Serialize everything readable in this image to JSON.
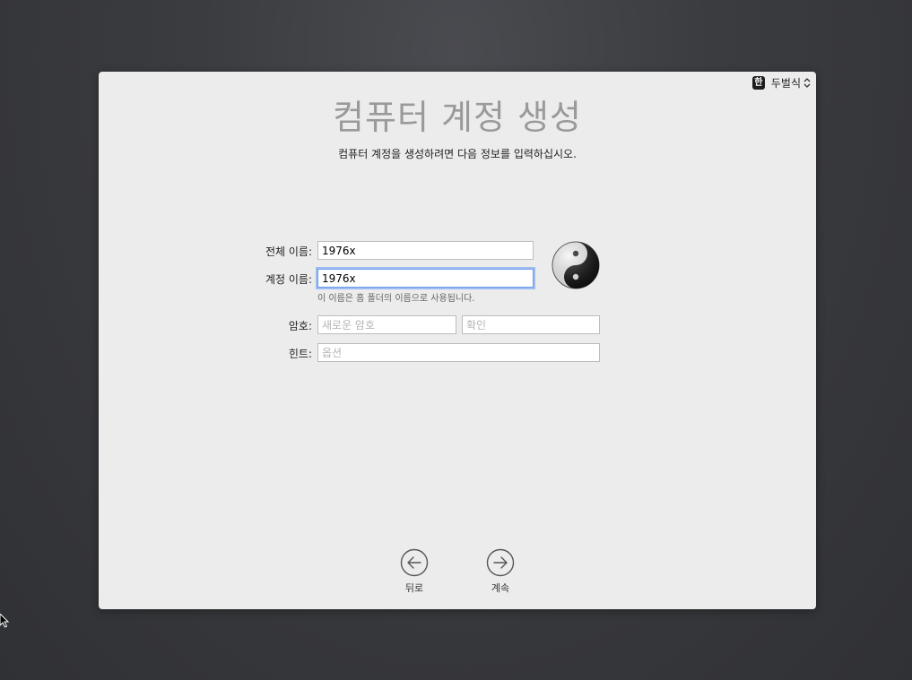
{
  "input_source": {
    "badge": "한",
    "name": "두벌식"
  },
  "header": {
    "title": "컴퓨터 계정 생성",
    "subtitle": "컴퓨터 계정을 생성하려면 다음 정보를 입력하십시오."
  },
  "form": {
    "full_name_label": "전체 이름:",
    "full_name_value": "1976x",
    "account_name_label": "계정 이름:",
    "account_name_value": "1976x",
    "account_name_note": "이 이름은 홈 폴더의 이름으로 사용됩니다.",
    "password_label": "암호:",
    "password_placeholder": "새로운 암호",
    "verify_placeholder": "확인",
    "hint_label": "힌트:",
    "hint_placeholder": "옵션"
  },
  "nav": {
    "back_label": "뒤로",
    "continue_label": "계속"
  },
  "colors": {
    "focus_ring": "#9dbdf2",
    "title_gray": "#9a9a9a",
    "panel_bg": "#ececec"
  }
}
